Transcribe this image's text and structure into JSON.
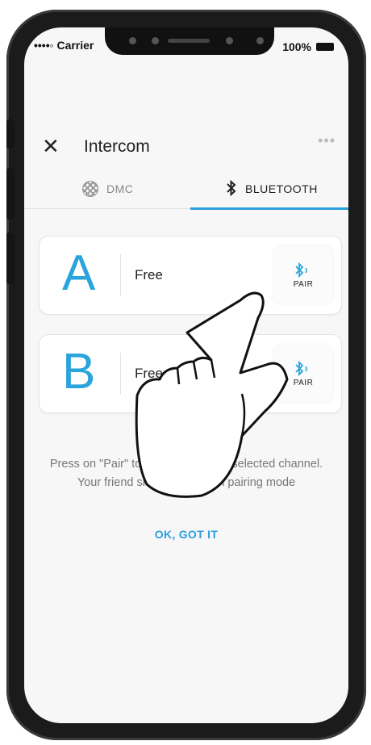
{
  "status_bar": {
    "carrier": "••••◦ Carrier",
    "battery": "100%"
  },
  "header": {
    "title": "Intercom",
    "close_icon": "close-icon",
    "more_icon": "more-icon"
  },
  "tabs": [
    {
      "label": "DMC",
      "icon": "dmc-icon",
      "active": false
    },
    {
      "label": "BLUETOOTH",
      "icon": "bluetooth-icon",
      "active": true
    }
  ],
  "channels": [
    {
      "letter": "A",
      "status": "Free",
      "pair_label": "PAIR"
    },
    {
      "letter": "B",
      "status": "Free",
      "pair_label": "PAIR"
    }
  ],
  "instructions": "Press on \"Pair\" to add a friend into selected channel. Your friend should also be in pairing mode",
  "ok_button": "OK, GOT IT",
  "colors": {
    "accent": "#2b9fe0",
    "letter": "#2aa4dc"
  }
}
